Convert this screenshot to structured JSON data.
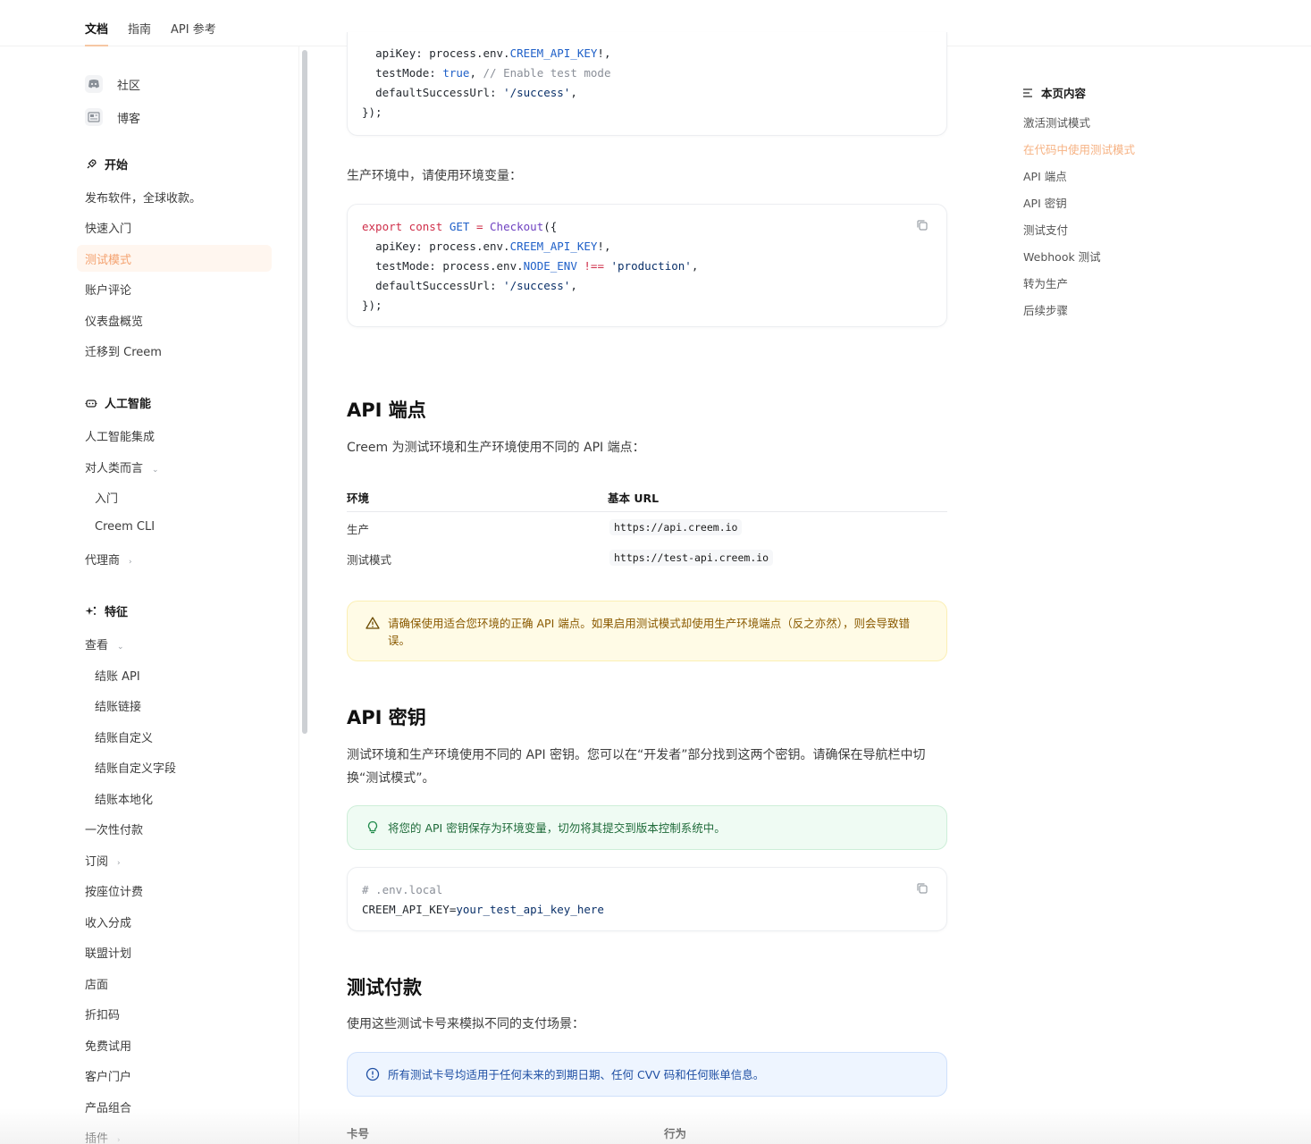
{
  "topnav": {
    "tabs": [
      "文档",
      "指南",
      "API 参考"
    ]
  },
  "sidebar": {
    "links": [
      "社区",
      "博客"
    ],
    "section_start": {
      "title": "开始",
      "items": [
        "发布软件，全球收款。",
        "快速入门",
        "测试模式",
        "账户评论",
        "仪表盘概览",
        "迁移到 Creem"
      ]
    },
    "section_ai": {
      "title": "人工智能",
      "items": [
        "人工智能集成",
        "对人类而言",
        "入门",
        "Creem CLI",
        "代理商"
      ]
    },
    "section_features": {
      "title": "特征",
      "items": [
        "查看",
        "结账 API",
        "结账链接",
        "结账自定义",
        "结账自定义字段",
        "结账本地化",
        "一次性付款",
        "订阅",
        "按座位计费",
        "收入分成",
        "联盟计划",
        "店面",
        "折扣码",
        "免费试用",
        "客户门户",
        "产品组合",
        "插件"
      ]
    }
  },
  "main": {
    "code1": {
      "lines": [
        {
          "a": "apiKey: process.env.",
          "b": "CREEM_API_KEY",
          "c": "!,"
        },
        {
          "a": "testMode: ",
          "b": "true",
          "c": ", ",
          "d": "// Enable test mode"
        },
        {
          "a": "defaultSuccessUrl: ",
          "b": "'/success'",
          "c": ","
        },
        {
          "a": "});"
        }
      ]
    },
    "prod_text": "生产环境中，请使用环境变量：",
    "code2": {
      "l1": {
        "kw": "export const",
        "cn": "GET",
        "eq": "=",
        "fn": "Checkout",
        "rest": "({"
      },
      "l2": {
        "a": "apiKey: process.env.",
        "b": "CREEM_API_KEY",
        "c": "!,"
      },
      "l3": {
        "a": "testMode: process.env.",
        "b": "NODE_ENV",
        "op": "!==",
        "s": "'production'",
        "c": ","
      },
      "l4": {
        "a": "defaultSuccessUrl: ",
        "b": "'/success'",
        "c": ","
      },
      "l5": "});"
    },
    "endpoints": {
      "heading": "API 端点",
      "intro": "Creem 为测试环境和生产环境使用不同的 API 端点：",
      "col_env": "环境",
      "col_url": "基本 URL",
      "rows": [
        {
          "env": "生产",
          "url": "https://api.creem.io"
        },
        {
          "env": "测试模式",
          "url": "https://test-api.creem.io"
        }
      ],
      "warning": "请确保使用适合您环境的正确 API 端点。如果启用测试模式却使用生产环境端点（反之亦然），则会导致错误。"
    },
    "keys": {
      "heading": "API 密钥",
      "intro": "测试环境和生产环境使用不同的 API 密钥。您可以在“开发者”部分找到这两个密钥。请确保在导航栏中切换“测试模式”。",
      "tip": "将您的 API 密钥保存为环境变量，切勿将其提交到版本控制系统中。",
      "env_comment": "# .env.local",
      "env_key": "CREEM_API_KEY",
      "env_value": "your_test_api_key_here"
    },
    "payments": {
      "heading": "测试付款",
      "intro": "使用这些测试卡号来模拟不同的支付场景：",
      "info": "所有测试卡号均适用于任何未来的到期日期、任何 CVV 码和任何账单信息。",
      "col_card": "卡号",
      "col_behavior": "行为"
    }
  },
  "toc": {
    "title": "本页内容",
    "items": [
      "激活测试模式",
      "在代码中使用测试模式",
      "API 端点",
      "API 密钥",
      "测试支付",
      "Webhook 测试",
      "转为生产",
      "后续步骤"
    ],
    "active_index": 1
  },
  "colors": {
    "accent": "#f4a16e",
    "warning_bg": "#fffbe6",
    "tip_bg": "#effbf3",
    "info_bg": "#eef5ff"
  }
}
